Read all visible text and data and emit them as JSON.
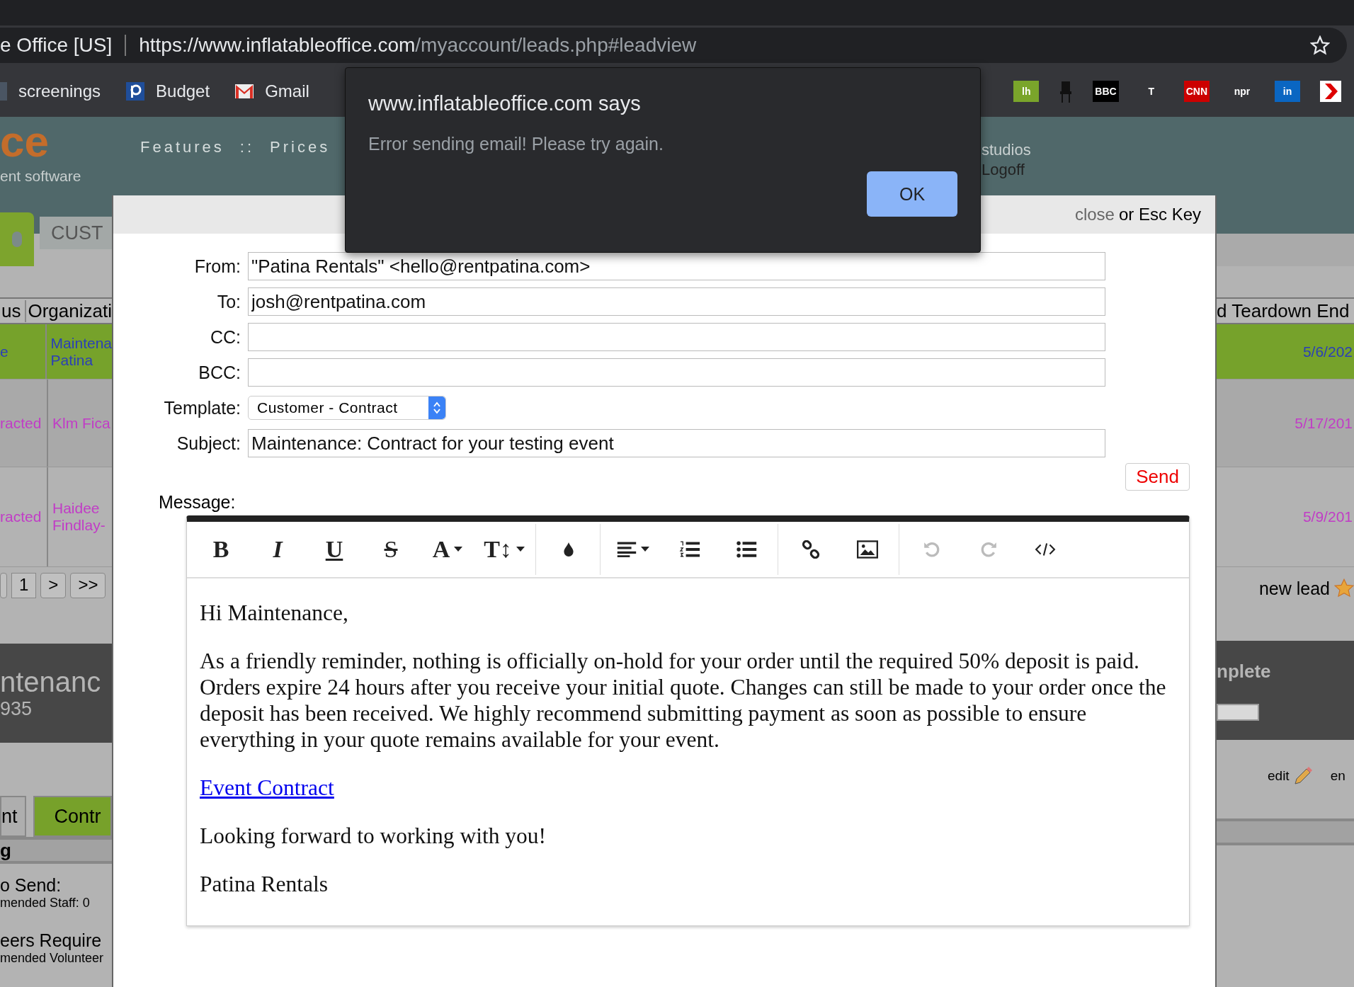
{
  "browser": {
    "site_label": "e Office [US]",
    "url_host": "https://www.inflatableoffice.com",
    "url_path": "/myaccount/leads.php#leadview",
    "bookmarks": [
      {
        "kind": "s",
        "label": "screenings"
      },
      {
        "kind": "p",
        "label": "Budget"
      },
      {
        "kind": "mail",
        "label": "Gmail"
      }
    ],
    "icon_bookmarks": [
      {
        "kind": "badge",
        "text": "lh",
        "color": "#7aa52b"
      },
      {
        "kind": "chair"
      },
      {
        "kind": "badge",
        "text": "BBC",
        "color": "#000000"
      },
      {
        "kind": "badge",
        "text": "T",
        "color": "#35363a"
      },
      {
        "kind": "badge",
        "text": "CNN",
        "color": "#cc0000"
      },
      {
        "kind": "badge",
        "text": "npr",
        "color": "#35363a"
      },
      {
        "kind": "badge",
        "text": "in",
        "color": "#0a66c2"
      },
      {
        "kind": "arrow"
      }
    ]
  },
  "header": {
    "logo": "ce",
    "tagline": "ent software",
    "nav": [
      "Features",
      "::",
      "Prices"
    ],
    "right_links": [
      "studios",
      "Logoff"
    ]
  },
  "left": {
    "tabs": [
      "CUST"
    ],
    "columns": [
      "us",
      "Organizati"
    ],
    "rows": [
      {
        "status": "e",
        "org": [
          "Maintena",
          "Patina"
        ],
        "selected": true
      },
      {
        "status": "racted",
        "org": [
          "Klm Fica"
        ],
        "selected": false
      },
      {
        "status": "racted",
        "org": [
          "Haidee",
          "Findlay-"
        ],
        "selected": false
      }
    ],
    "pages": [
      "1",
      ">",
      ">>"
    ],
    "banner_title": "ntenanc",
    "banner_sub": "935",
    "subtabs": [
      {
        "label": "nt",
        "selected": false
      },
      {
        "label": "Contr",
        "selected": true
      }
    ],
    "section": "g",
    "staff_title": "o Send:",
    "staff_sub": "mended Staff: 0",
    "vol_title": "eers Require",
    "vol_sub": "mended Volunteer"
  },
  "right": {
    "column": "d Teardown End",
    "dates": [
      "5/6/202",
      "5/17/201",
      "5/9/201"
    ],
    "new_lead": "new lead",
    "banner": "nplete",
    "progress": {
      "level": 1
    },
    "edit": "edit",
    "edit_next": "en"
  },
  "modal": {
    "close_link": "close",
    "close_hint": "or Esc Key",
    "fields": [
      {
        "kind": "text",
        "label": "From:",
        "value": "\"Patina Rentals\" <hello@rentpatina.com>"
      },
      {
        "kind": "text",
        "label": "To:",
        "value": "josh@rentpatina.com"
      },
      {
        "kind": "text",
        "label": "CC:"
      },
      {
        "kind": "text",
        "label": "BCC:"
      },
      {
        "kind": "select",
        "label": "Template:",
        "value": "Customer - Contract"
      },
      {
        "kind": "text",
        "label": "Subject:",
        "value": "Maintenance: Contract for your testing event"
      }
    ],
    "send": "Send",
    "message_label": "Message:",
    "toolbar": [
      [
        {
          "kind": "bold",
          "text": "B"
        },
        {
          "kind": "italic",
          "text": "I"
        },
        {
          "kind": "underline",
          "text": "U"
        },
        {
          "kind": "strike",
          "text": "S"
        },
        {
          "kind": "font",
          "text": "A",
          "caret": true
        },
        {
          "kind": "size",
          "text": "T↕",
          "caret": true
        }
      ],
      [
        {
          "kind": "drop"
        }
      ],
      [
        {
          "kind": "align",
          "caret": true
        },
        {
          "kind": "ol"
        },
        {
          "kind": "ul"
        }
      ],
      [
        {
          "kind": "link"
        },
        {
          "kind": "image"
        }
      ],
      [
        {
          "kind": "undo",
          "disabled": true
        },
        {
          "kind": "redo",
          "disabled": true
        },
        {
          "kind": "code"
        }
      ]
    ],
    "body": [
      {
        "kind": "text",
        "text": "Hi Maintenance,"
      },
      {
        "kind": "text",
        "text": "As a friendly reminder, nothing is officially on-hold for your order until the required 50% deposit is paid. Orders expire 24 hours after you receive your initial quote. Changes can still be made to your order once the deposit has been received. We highly recommend submitting payment as soon as possible to ensure everything in your quote remains available for your event."
      },
      {
        "kind": "link",
        "text": "Event Contract"
      },
      {
        "kind": "text",
        "text": "Looking forward to working with you!"
      },
      {
        "kind": "text",
        "text": "Patina Rentals"
      }
    ]
  },
  "alert": {
    "title": "www.inflatableoffice.com says",
    "message": "Error sending email! Please try again.",
    "button": "OK"
  }
}
